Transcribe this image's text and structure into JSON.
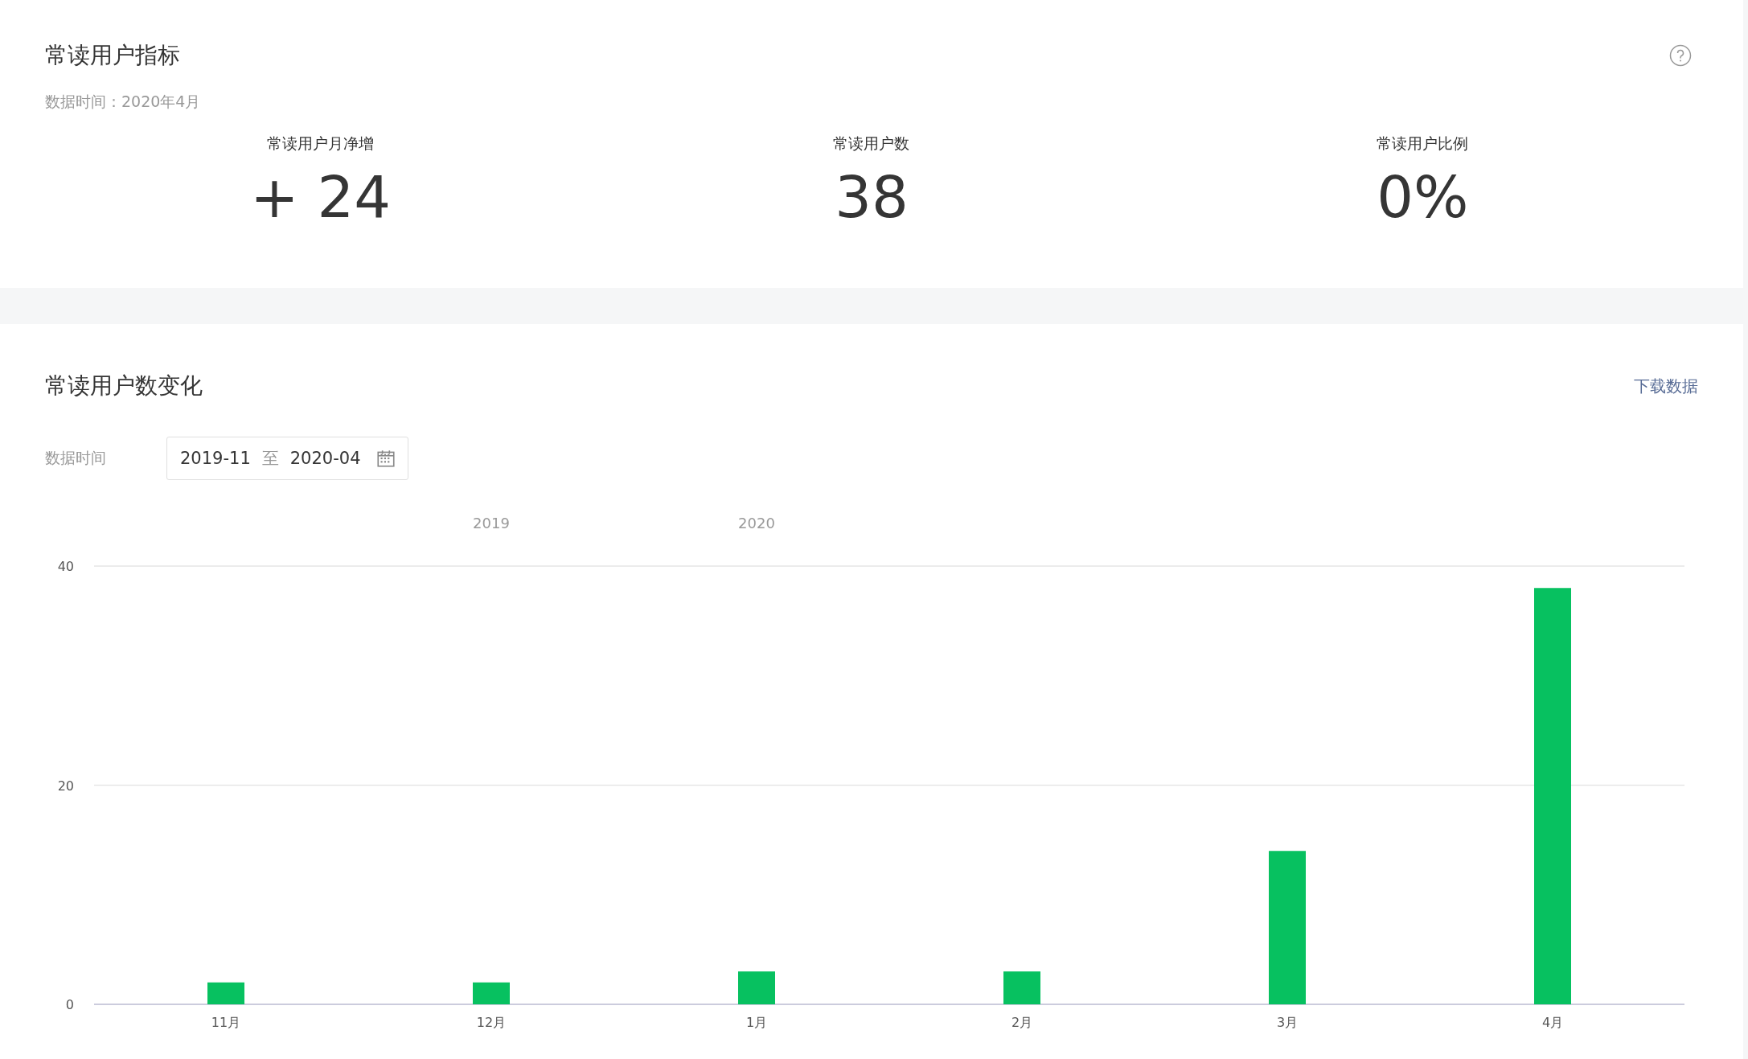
{
  "overview": {
    "title": "常读用户指标",
    "data_time": "数据时间：2020年4月",
    "metrics": [
      {
        "label": "常读用户月净增",
        "value": "+ 24"
      },
      {
        "label": "常读用户数",
        "value": "38"
      },
      {
        "label": "常读用户比例",
        "value": "0%"
      }
    ]
  },
  "trend": {
    "title": "常读用户数变化",
    "download_link": "下载数据",
    "date_label": "数据时间",
    "date_range": {
      "start": "2019-11",
      "separator": "至",
      "end": "2020-04"
    },
    "year_labels": [
      "2019",
      "2020"
    ],
    "chart_data": {
      "type": "bar",
      "categories": [
        "11月",
        "12月",
        "1月",
        "2月",
        "3月",
        "4月"
      ],
      "series": [
        {
          "color": "#07c160",
          "values": [
            2,
            2,
            3,
            3,
            14,
            38
          ]
        }
      ],
      "ylim": [
        0,
        40
      ],
      "yticks": [
        0,
        20,
        40
      ]
    }
  }
}
